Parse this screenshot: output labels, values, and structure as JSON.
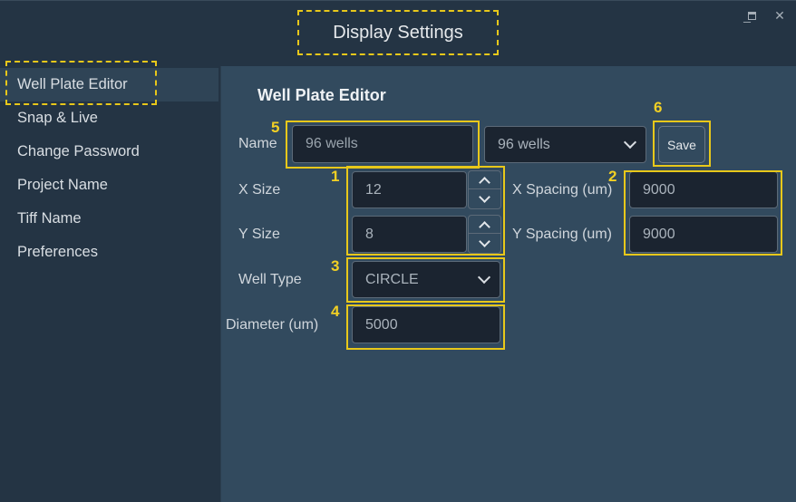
{
  "window": {
    "title": "Display Settings",
    "controls": {
      "minimize": "_",
      "maximize": "maximize-icon",
      "close": "✕"
    }
  },
  "sidebar": {
    "items": [
      {
        "label": "Well Plate Editor",
        "active": true
      },
      {
        "label": "Snap & Live",
        "active": false
      },
      {
        "label": "Change Password",
        "active": false
      },
      {
        "label": "Project Name",
        "active": false
      },
      {
        "label": "Tiff Name",
        "active": false
      },
      {
        "label": "Preferences",
        "active": false
      }
    ]
  },
  "main": {
    "heading": "Well Plate Editor",
    "name": {
      "label": "Name",
      "value": "96 wells"
    },
    "preset": {
      "selected": "96 wells"
    },
    "save_label": "Save",
    "x_size": {
      "label": "X Size",
      "value": "12"
    },
    "y_size": {
      "label": "Y Size",
      "value": "8"
    },
    "x_spacing": {
      "label": "X Spacing (um)",
      "value": "9000"
    },
    "y_spacing": {
      "label": "Y Spacing (um)",
      "value": "9000"
    },
    "well_type": {
      "label": "Well Type",
      "selected": "CIRCLE"
    },
    "diameter": {
      "label": "Diameter (um)",
      "value": "5000"
    }
  },
  "annotations": {
    "color": "#e8c81a",
    "labels": [
      "1",
      "2",
      "3",
      "4",
      "5",
      "6"
    ]
  }
}
